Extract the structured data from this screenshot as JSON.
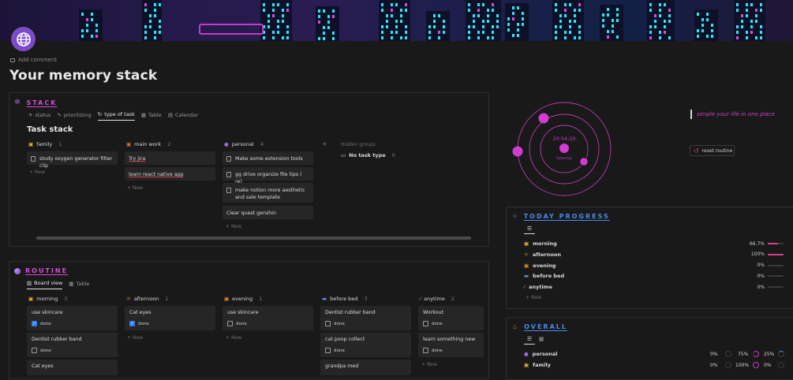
{
  "page": {
    "add_comment": "Add comment",
    "title": "Your memory stack"
  },
  "colors": {
    "accent_pink": "#d34cd7",
    "accent_blue": "#3f7fe0",
    "purple": "#9b4fd6",
    "progress": "#d93f8e"
  },
  "stack": {
    "heading": "STACK",
    "tabs": [
      "status",
      "prioritizing",
      "type of task",
      "Table",
      "Calendar"
    ],
    "active_tab": "type of task",
    "subtitle": "Task stack",
    "columns": [
      {
        "name": "family",
        "count": "1",
        "cards": [
          "study oxygen generator filter clip"
        ]
      },
      {
        "name": "main work",
        "count": "2",
        "cards": [
          "Try jira",
          "learn react native app"
        ]
      },
      {
        "name": "personal",
        "count": "4",
        "cards": [
          "Make some extension tools",
          "gg drive organize file tips ( re)",
          "make notion more aesthetic and sale template",
          "Clear quest genshin"
        ]
      }
    ],
    "new_label": "New",
    "add_symbol": "+",
    "hidden_groups": "Hidden groups",
    "no_task_type": "No task type",
    "no_task_count": "0"
  },
  "routine": {
    "heading": "ROUTINE",
    "tabs": [
      "Board view",
      "Table"
    ],
    "columns": [
      {
        "name": "morning",
        "count": "3",
        "cards": [
          {
            "title": "use skincare",
            "done": true
          },
          {
            "title": "Dentist rubber band",
            "done": false
          },
          {
            "title": "Cat eyes",
            "done": false
          }
        ]
      },
      {
        "name": "afternoon",
        "count": "1",
        "cards": [
          {
            "title": "Cat eyes",
            "done": true
          }
        ]
      },
      {
        "name": "evening",
        "count": "1",
        "cards": [
          {
            "title": "use skincare",
            "done": false
          }
        ]
      },
      {
        "name": "before bed",
        "count": "3",
        "cards": [
          {
            "title": "Dentist rubber band",
            "done": false
          },
          {
            "title": "cat poop collect",
            "done": false
          },
          {
            "title": "grandpa med",
            "done": false
          }
        ]
      },
      {
        "name": "anytime",
        "count": "2",
        "cards": [
          {
            "title": "Workout",
            "done": false
          },
          {
            "title": "learn something new",
            "done": false
          }
        ]
      }
    ],
    "done_label": "done",
    "new_label": "New"
  },
  "clock": {
    "time": "20:54:20",
    "day": "Saturday"
  },
  "quote": "simple your life in one place",
  "reset_routine": "reset routine",
  "today_progress": {
    "heading": "TODAY PROGRESS",
    "rows": [
      {
        "label": "morning",
        "pct": "66.7%",
        "value": 0.667
      },
      {
        "label": "afternoon",
        "pct": "100%",
        "value": 1.0
      },
      {
        "label": "evening",
        "pct": "0%",
        "value": 0
      },
      {
        "label": "before bed",
        "pct": "0%",
        "value": 0
      },
      {
        "label": "anytime",
        "pct": "0%",
        "value": 0
      }
    ],
    "new_label": "New"
  },
  "overall": {
    "heading": "OVERALL",
    "rows": [
      {
        "label": "personal",
        "a": "0%",
        "b": "75%",
        "c": "25%"
      },
      {
        "label": "family",
        "a": "0%",
        "b": "100%",
        "c": "0%"
      }
    ]
  }
}
